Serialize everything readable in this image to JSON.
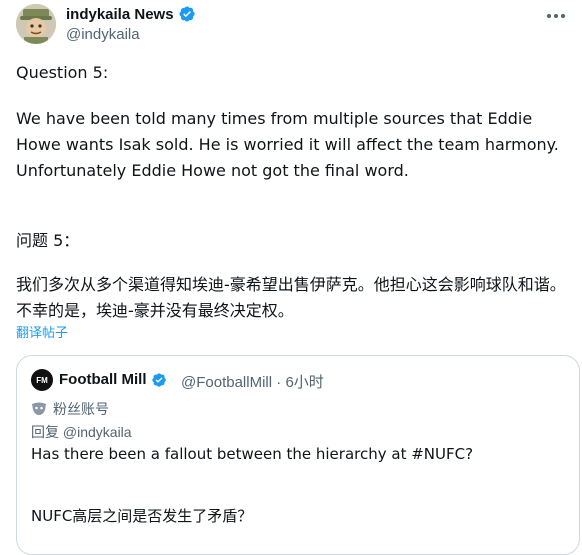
{
  "author": {
    "name": "indykaila News",
    "handle": "@indykaila"
  },
  "tweet": {
    "heading_en": "Question 5:",
    "body_en": "We have been told many times from multiple sources that Eddie Howe wants Isak sold. He is worried it will affect the team harmony. Unfortunately Eddie Howe not got the final word.",
    "heading_zh": "问题 5：",
    "body_zh": "我们多次从多个渠道得知埃迪-豪希望出售伊萨克。他担心这会影响球队和谐。不幸的是，埃迪-豪并没有最终决定权。",
    "translate_link": "翻译帖子"
  },
  "quote": {
    "avatar_text": "FM",
    "name": "Football Mill",
    "handle": "@FootballMill",
    "separator": "·",
    "time": "6小时",
    "account_label": "粉丝账号",
    "reply_to": "回复 @indykaila",
    "text_en": "Has there been a fallout between the hierarchy at #NUFC?",
    "text_zh": "NUFC高层之间是否发生了矛盾？"
  },
  "colors": {
    "verified": "#1d9bf0",
    "link": "#1d9bf0",
    "secondary": "#536471"
  }
}
